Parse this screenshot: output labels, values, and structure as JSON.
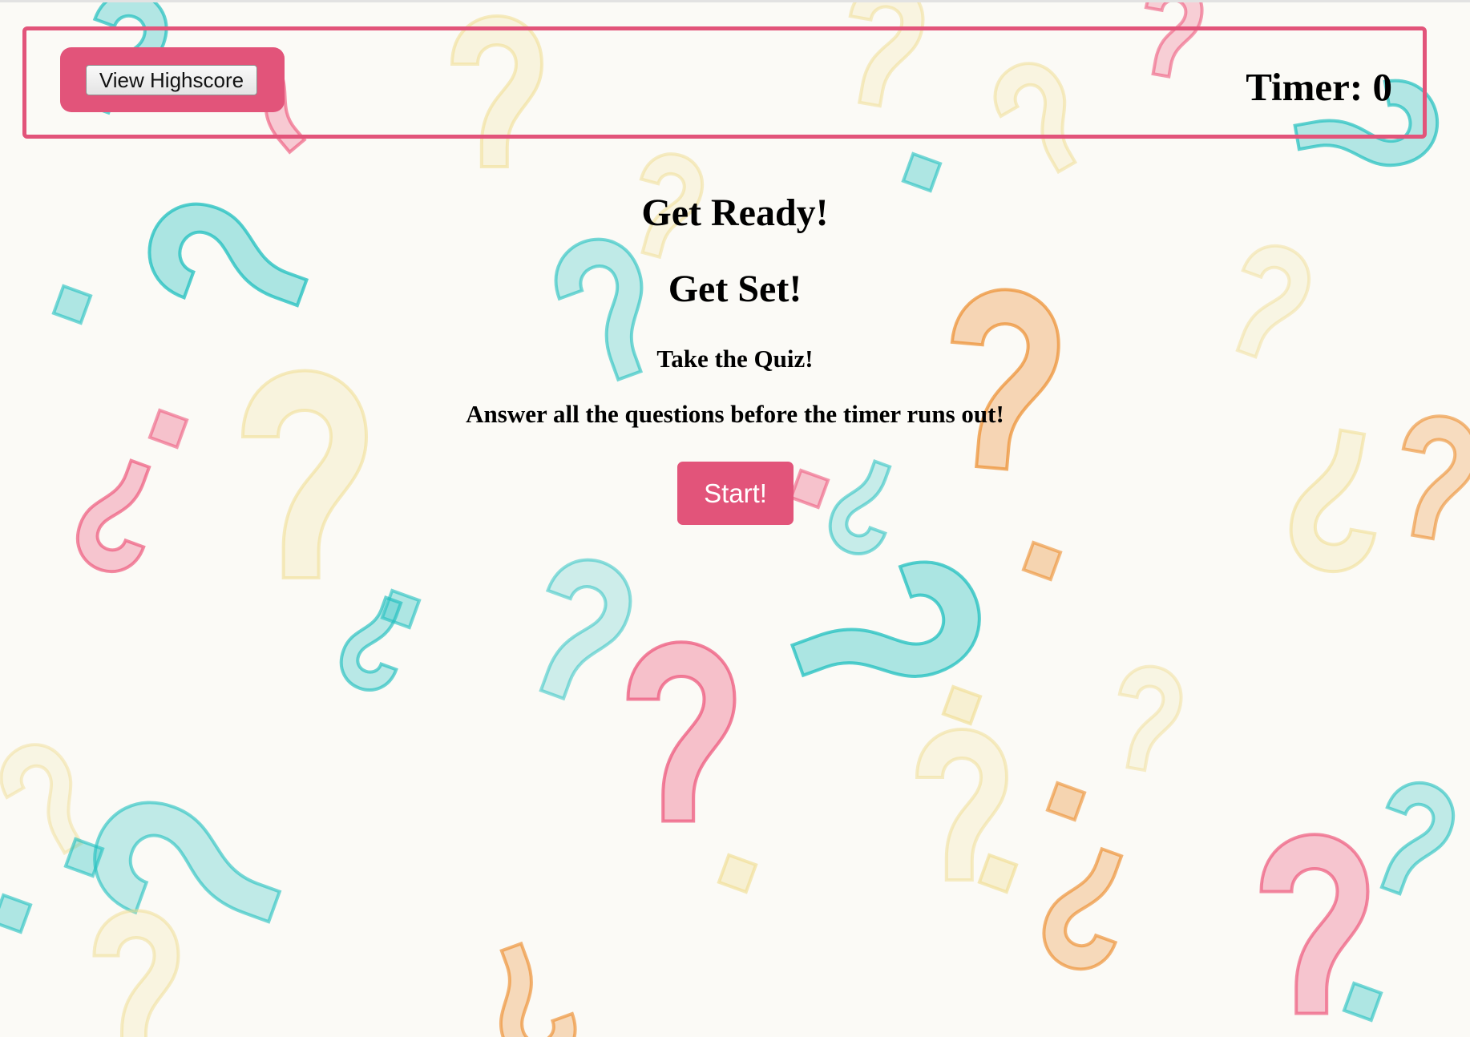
{
  "header": {
    "highscore_label": "View Highscore",
    "timer_label": "Timer:",
    "timer_value": "0"
  },
  "main": {
    "heading_ready": "Get Ready!",
    "heading_set": "Get Set!",
    "subtitle": "Take the Quiz!",
    "instructions": "Answer all the questions before the timer runs out!",
    "start_label": "Start!"
  },
  "colors": {
    "accent": "#e2547a",
    "teal": "#1fbfbf",
    "pink": "#ee5a7e",
    "yellow": "#f0dc8e",
    "orange": "#ec8d2e"
  },
  "background": {
    "icon": "question-mark-pattern"
  }
}
